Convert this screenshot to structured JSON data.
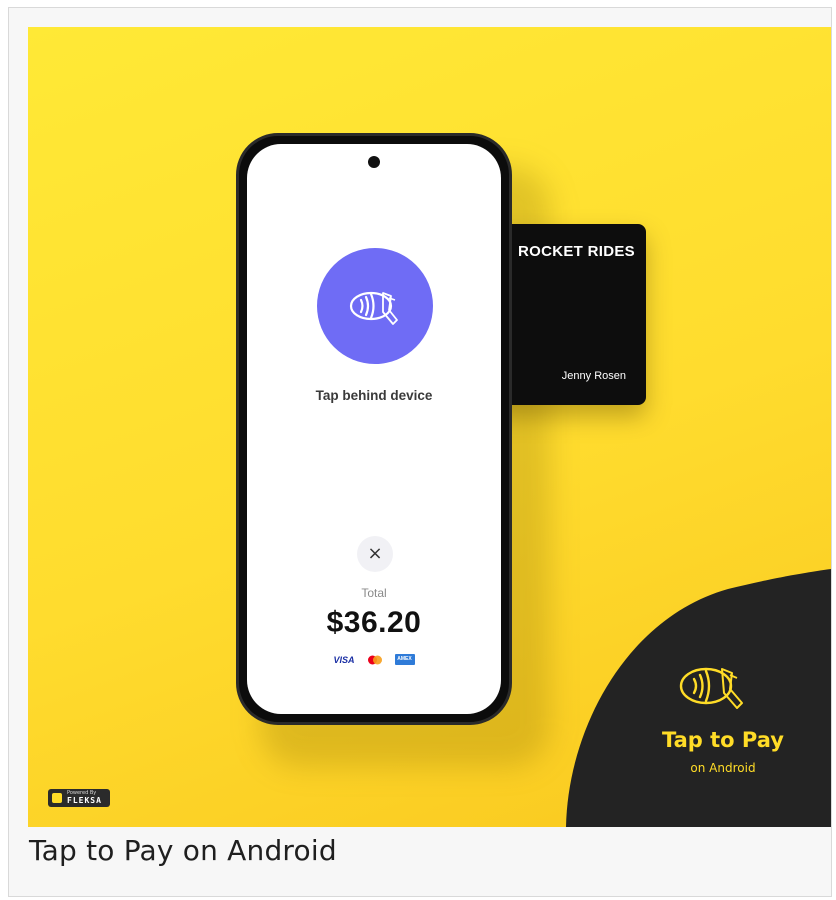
{
  "caption": "Tap to Pay on Android",
  "phone": {
    "prompt": "Tap behind device",
    "close_glyph": "×",
    "total_label": "Total",
    "amount": "$36.20",
    "brands": {
      "visa": "VISA",
      "amex": "AMEX"
    },
    "icons": [
      "camera-icon",
      "contactless-tap-icon",
      "close-icon",
      "mastercard-icon"
    ],
    "accent_color": "#6f6cf5"
  },
  "card": {
    "title": "ROCKET RIDES",
    "holder": "Jenny Rosen"
  },
  "badge": {
    "title": "Tap to Pay",
    "subtitle": "on Android",
    "color": "#ffdc27",
    "background": "#232323",
    "icon": "contactless-tap-icon"
  },
  "powered_by": {
    "small": "Powered By",
    "name": "FLEKSA"
  },
  "colors": {
    "hero_yellow": "#ffe330",
    "phone_body": "#0c0c0c"
  }
}
